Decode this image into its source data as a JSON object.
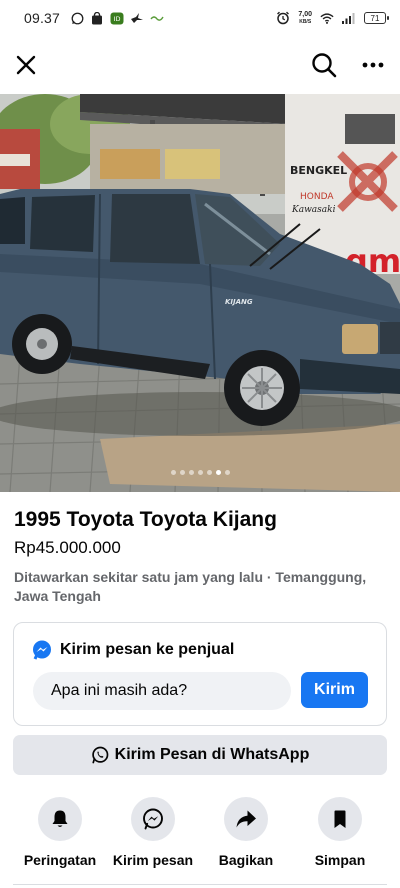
{
  "status_bar": {
    "time": "09.37",
    "speed_value": "7,00",
    "speed_unit": "KB/S",
    "battery": "71"
  },
  "nav": {
    "close_icon": "close-icon",
    "search_icon": "search-icon",
    "more_icon": "more-horizontal-icon"
  },
  "photo": {
    "sign_text_1": "BENGKEL",
    "sign_text_2": "HONDA",
    "sign_text_3": "Kawasaki",
    "sign_text_4": "gm",
    "car_badge": "KIJANG",
    "slide_count": 7,
    "active_slide": 6
  },
  "listing": {
    "title": "1995 Toyota Toyota Kijang",
    "price": "Rp45.000.000",
    "meta": "Ditawarkan sekitar satu jam yang lalu · Temanggung, Jawa Tengah"
  },
  "message_card": {
    "heading": "Kirim pesan ke penjual",
    "input_value": "Apa ini masih ada?",
    "send_label": "Kirim"
  },
  "whatsapp": {
    "label": "Kirim Pesan di WhatsApp"
  },
  "actions": [
    {
      "label": "Peringatan",
      "icon": "bell-icon"
    },
    {
      "label": "Kirim pesan",
      "icon": "messenger-icon"
    },
    {
      "label": "Bagikan",
      "icon": "share-icon"
    },
    {
      "label": "Simpan",
      "icon": "bookmark-icon"
    }
  ],
  "colors": {
    "accent": "#1877f2",
    "button_gray": "#e4e6eb",
    "input_bg": "#f0f2f5",
    "meta_text": "#65676b"
  }
}
